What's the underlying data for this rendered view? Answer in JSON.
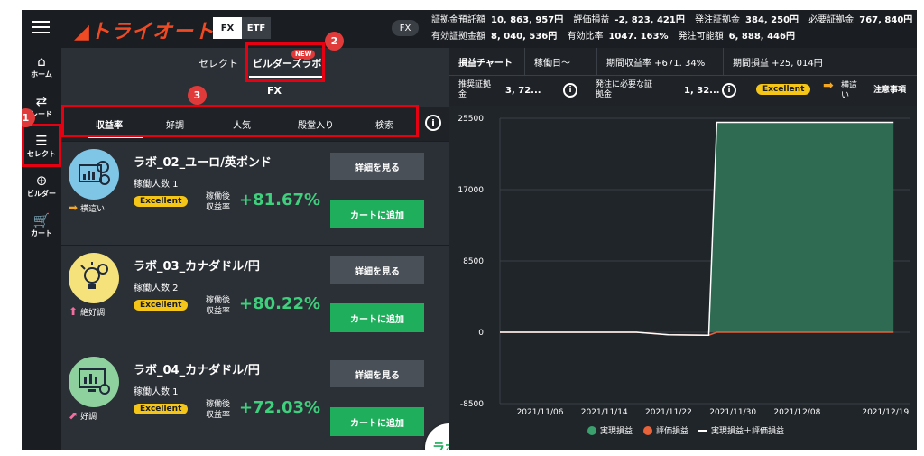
{
  "header": {
    "logo_text": "トライオート",
    "segments": [
      {
        "label": "FX"
      },
      {
        "label": "ETF"
      }
    ],
    "market_pill": "FX",
    "stats_row1": [
      {
        "label": "証拠金預託額",
        "value": "10, 863, 957円"
      },
      {
        "label": "評価損益",
        "value": "-2, 823, 421円"
      },
      {
        "label": "発注証拠金",
        "value": "384, 250円"
      },
      {
        "label": "必要証拠金",
        "value": "767, 840円"
      }
    ],
    "stats_row2": [
      {
        "label": "有効証拠金額",
        "value": "8, 040, 536円"
      },
      {
        "label": "有効比率",
        "value": "1047. 163%"
      },
      {
        "label": "発注可能額",
        "value": "6, 888, 446円"
      }
    ]
  },
  "sidebar": {
    "items": [
      {
        "icon": "⌂",
        "label": "ホーム"
      },
      {
        "icon": "⇄",
        "label": "レード"
      },
      {
        "icon": "☰",
        "label": "セレクト"
      },
      {
        "icon": "⊕",
        "label": "ビルダー"
      },
      {
        "icon": "🛒",
        "label": "カート"
      }
    ]
  },
  "left": {
    "tabs": [
      {
        "label": "セレクト"
      },
      {
        "label": "ビルダーズラボ"
      }
    ],
    "new_badge": "NEW",
    "fx_label": "FX",
    "filters": [
      {
        "label": "収益率"
      },
      {
        "label": "好調"
      },
      {
        "label": "人気"
      },
      {
        "label": "殿堂入り"
      },
      {
        "label": "検索"
      }
    ],
    "info_symbol": "i",
    "cards": [
      {
        "name": "ラボ_02_ユーロ/英ポンド",
        "people": "稼働人数 1",
        "grade": "Excellent",
        "rate_label_1": "稼働後",
        "rate_label_2": "収益率",
        "rate": "+81.67%",
        "trend": "横這い",
        "detail": "詳細を見る",
        "cart": "カートに追加"
      },
      {
        "name": "ラボ_03_カナダドル/円",
        "people": "稼働人数 2",
        "grade": "Excellent",
        "rate_label_1": "稼働後",
        "rate_label_2": "収益率",
        "rate": "+80.22%",
        "trend": "絶好調",
        "detail": "詳細を見る",
        "cart": "カートに追加"
      },
      {
        "name": "ラボ_04_カナダドル/円",
        "people": "稼働人数 1",
        "grade": "Excellent",
        "rate_label_1": "稼働後",
        "rate_label_2": "収益率",
        "rate": "+72.03%",
        "trend": "好調",
        "detail": "詳細を見る",
        "cart": "カートに追加"
      }
    ],
    "fab_label": "ラボ"
  },
  "right": {
    "tabs": [
      {
        "label": "損益チャート"
      },
      {
        "label": "稼働日〜"
      },
      {
        "label": "期間収益率 +671. 34%"
      },
      {
        "label": "期間損益 +25, 014円"
      }
    ],
    "info": {
      "recommended_label_1": "推奨証拠",
      "recommended_label_2": "金",
      "recommended_value": "3, 72...",
      "required_label_1": "発注に必要な証",
      "required_label_2": "拠金",
      "required_value": "1, 32...",
      "grade": "Excellent",
      "trend_1": "横這",
      "trend_2": "い",
      "notice": "注意事項"
    }
  },
  "callouts": [
    "1",
    "2",
    "3"
  ],
  "chart_data": {
    "type": "area",
    "yticks": [
      25500,
      17000,
      8500,
      0,
      -8500
    ],
    "ylim": [
      -8500,
      25500
    ],
    "xticks": [
      "2021/11/06",
      "2021/11/14",
      "2021/11/22",
      "2021/11/30",
      "2021/12/08",
      "2021/12/19"
    ],
    "x": [
      "2021/11/01",
      "2021/11/18",
      "2021/11/22",
      "2021/11/27",
      "2021/11/27",
      "2021/11/28",
      "2021/12/20"
    ],
    "series": [
      {
        "name": "実現損益",
        "values": [
          0,
          0,
          0,
          0,
          0,
          25014,
          25014
        ]
      },
      {
        "name": "評価損益",
        "values": [
          0,
          0,
          -300,
          -350,
          -350,
          0,
          0
        ]
      },
      {
        "name": "実現損益＋評価損益",
        "values": [
          0,
          0,
          -300,
          -350,
          -350,
          25014,
          25014
        ]
      }
    ],
    "legend": [
      "実現損益",
      "評価損益",
      "実現損益＋評価損益"
    ],
    "colors": {
      "realized": "#2e6b52",
      "valuation": "#e8623a",
      "total": "#ffffff"
    },
    "grid": true,
    "legend_position": "bottom"
  }
}
